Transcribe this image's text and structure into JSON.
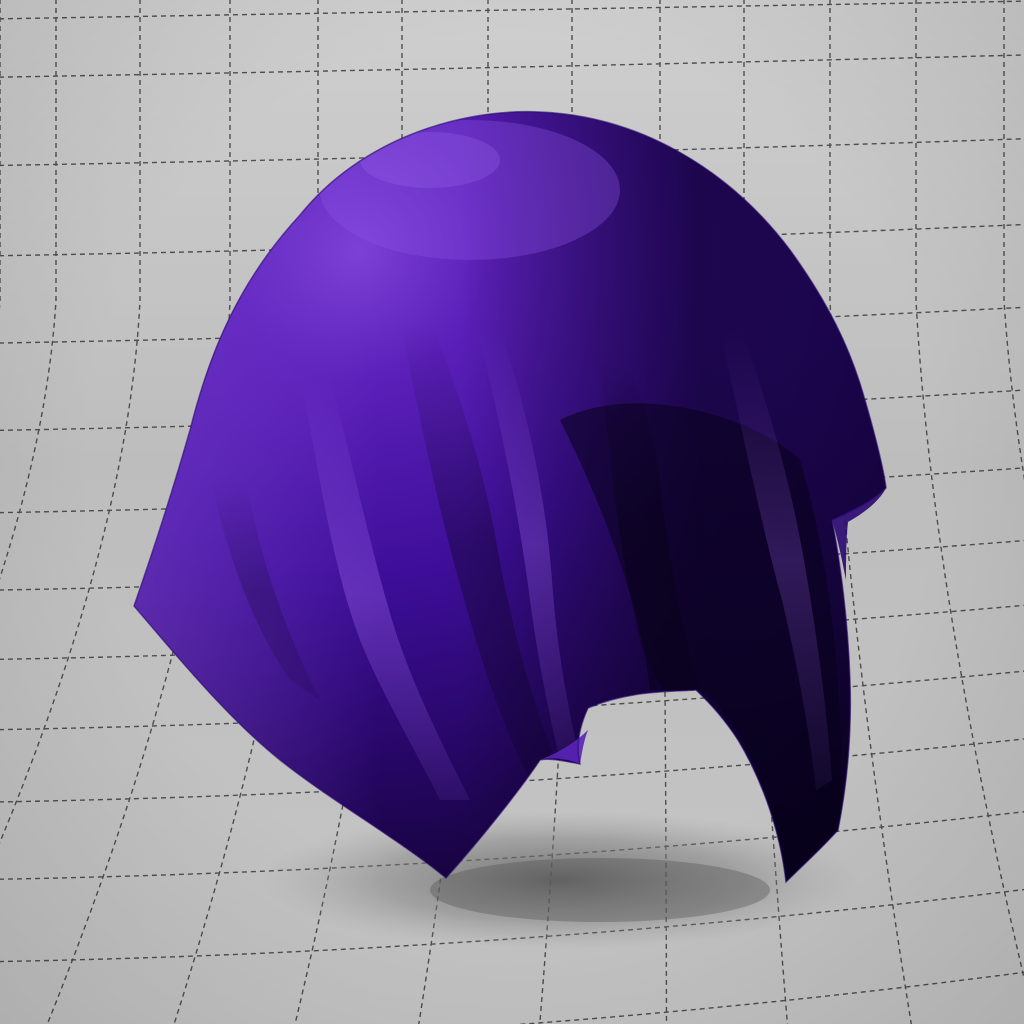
{
  "scene": {
    "subject": "draped-cloth-sphere",
    "colors": {
      "backdrop_light": "#d2d2d2",
      "backdrop_mid": "#bdbdbd",
      "backdrop_dark": "#a7a7a7",
      "grid_line": "#3a3a3a",
      "cloth_highlight": "#7b3fd4",
      "cloth_base": "#4a14a8",
      "cloth_mid": "#350c8a",
      "cloth_shadow": "#12042e",
      "cloth_rim": "#6a2cc8",
      "floor_shadow": "#7d7d7d"
    }
  }
}
